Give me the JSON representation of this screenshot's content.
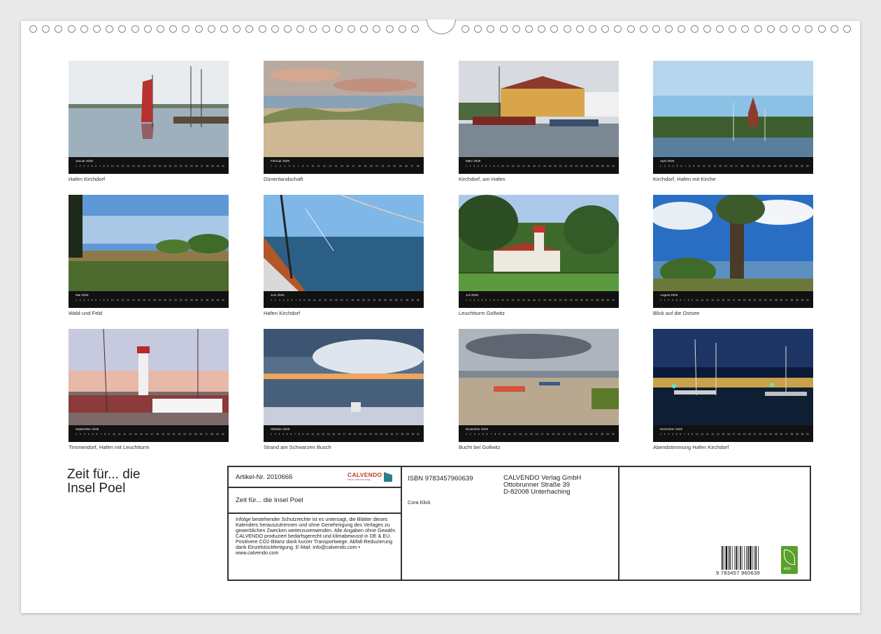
{
  "months": [
    {
      "name": "Januar 2026",
      "caption": "Hafen Kirchdorf"
    },
    {
      "name": "Februar 2026",
      "caption": "Dünenlandschaft"
    },
    {
      "name": "März 2026",
      "caption": "Kirchdorf, am Hafen"
    },
    {
      "name": "April 2026",
      "caption": "Kirchdorf, Hafen mit Kirche"
    },
    {
      "name": "Mai 2026",
      "caption": "Wald und Feld"
    },
    {
      "name": "Juni 2026",
      "caption": "Hafen Kirchdorf"
    },
    {
      "name": "Juli 2026",
      "caption": "Leuchtturm Gollwitz"
    },
    {
      "name": "August 2026",
      "caption": "Blick auf die Ostsee"
    },
    {
      "name": "September 2026",
      "caption": "Timmendorf, Hafen mit Leuchtturm"
    },
    {
      "name": "Oktober 2026",
      "caption": "Strand am Schwarzen Busch"
    },
    {
      "name": "November 2026",
      "caption": "Bucht bei Gollwitz"
    },
    {
      "name": "Dezember 2026",
      "caption": "Abendstimmung Hafen Kirchdorf"
    }
  ],
  "title": {
    "line1": "Zeit für... die",
    "line2": "Insel Poel"
  },
  "info": {
    "article": "Artikel-Nr. 2010666",
    "logo": "CALVENDO",
    "logo_sub": "Neue Kalenderverlag",
    "book_title": "Zeit für... die Insel Poel",
    "legal": "Infolge bestehender Schutzrechte ist es untersagt, die Blätter dieses Kalenders herauszutrennen und ohne Genehmigung des Verlages zu gewerblichen Zwecken weiterzuverwenden. Alle Angaben ohne Gewähr. CALVENDO produziert bedarfsgerecht und klimabewusst in DE & EU. Positivere CO2-Bilanz dank kurzer Transportwege. Abfall-Reduzierung dank Einzelstückfertigung. E-Mail: info@calvendo.com • www.calvendo.com",
    "isbn": "ISBN 9783457960639",
    "author": "Cora Klick",
    "publisher1": "CALVENDO Verlag GmbH",
    "publisher2": "Ottobrunner Straße 39",
    "publisher3": "D-82008 Unterhaching",
    "barcode_number": "9 783457 960639",
    "eco_label": "eco"
  }
}
